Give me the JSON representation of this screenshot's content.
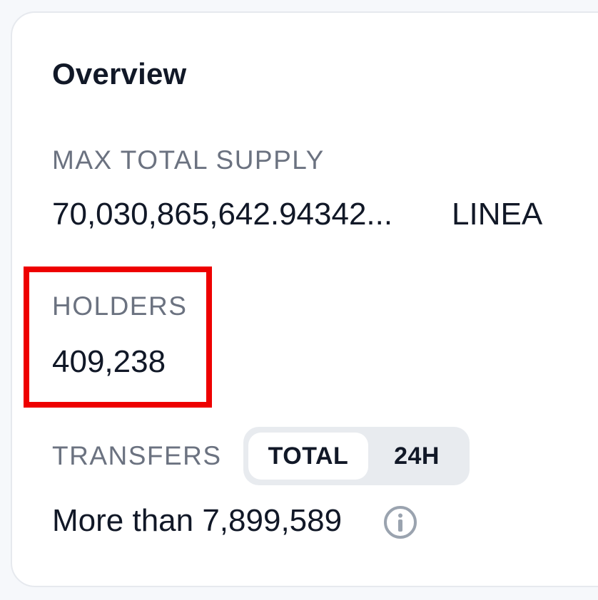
{
  "overview": {
    "title": "Overview",
    "max_total_supply": {
      "label": "MAX TOTAL SUPPLY",
      "value": "70,030,865,642.94342...",
      "unit": "LINEA"
    },
    "holders": {
      "label": "HOLDERS",
      "value": "409,238"
    },
    "transfers": {
      "label": "TRANSFERS",
      "toggle": {
        "options": [
          "TOTAL",
          "24H"
        ],
        "selected": "TOTAL"
      },
      "value": "More than 7,899,589"
    }
  },
  "colors": {
    "highlight": "#ee0000",
    "label": "#6b7280",
    "text": "#111827"
  },
  "icons": {
    "transfers_info": "info-icon"
  }
}
